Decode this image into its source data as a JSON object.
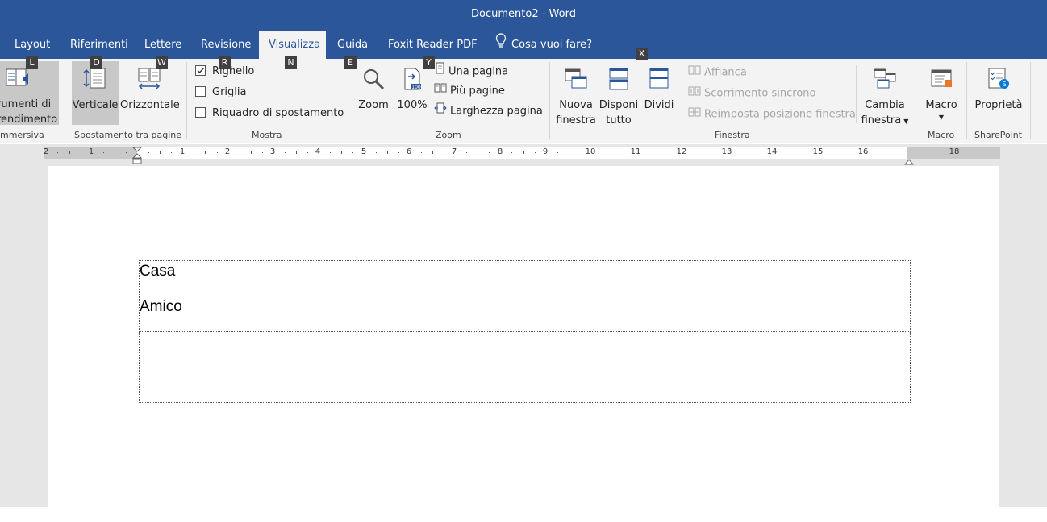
{
  "window": {
    "title": "Documento2  -  Word"
  },
  "tabs": [
    {
      "label": "Layout"
    },
    {
      "label": "Riferimenti"
    },
    {
      "label": "Lettere"
    },
    {
      "label": "Revisione"
    },
    {
      "label": "Visualizza"
    },
    {
      "label": "Guida"
    },
    {
      "label": "Foxit Reader PDF"
    },
    {
      "label": "Cosa vuoi fare?"
    }
  ],
  "active_tab": "Visualizza",
  "keytips": [
    "L",
    "D",
    "W",
    "R",
    "N",
    "E",
    "Y",
    "X"
  ],
  "ribbon": {
    "immersiva": {
      "button_line1": "rumenti di",
      "button_line2": "rendimento",
      "group_label": "mmersiva"
    },
    "spostamento": {
      "verticale": "Verticale",
      "orizzontale": "Orizzontale",
      "group_label": "Spostamento tra pagine"
    },
    "mostra": {
      "righello": "Righello",
      "griglia": "Griglia",
      "riquadro": "Riquadro di spostamento",
      "righello_checked": true,
      "griglia_checked": false,
      "riquadro_checked": false,
      "group_label": "Mostra"
    },
    "zoom": {
      "zoom": "Zoom",
      "cento": "100%",
      "una_pagina": "Una pagina",
      "piu_pagine": "Più pagine",
      "larghezza": "Larghezza pagina",
      "group_label": "Zoom"
    },
    "finestra": {
      "nuova_line1": "Nuova",
      "nuova_line2": "finestra",
      "disponi_line1": "Disponi",
      "disponi_line2": "tutto",
      "dividi": "Dividi",
      "affianca": "Affianca",
      "scorrimento": "Scorrimento sincrono",
      "reimposta": "Reimposta posizione finestra",
      "cambia_line1": "Cambia",
      "cambia_line2": "finestra",
      "group_label": "Finestra"
    },
    "macro": {
      "macro": "Macro",
      "group_label": "Macro"
    },
    "sharepoint": {
      "proprieta": "Proprietà",
      "group_label": "SharePoint"
    }
  },
  "ruler": {
    "labels": [
      "2",
      "1",
      "1",
      "2",
      "3",
      "4",
      "5",
      "6",
      "7",
      "8",
      "9",
      "10",
      "11",
      "12",
      "13",
      "14",
      "15",
      "16",
      "18"
    ]
  },
  "document": {
    "rows": [
      "Casa",
      "Amico",
      "",
      ""
    ]
  },
  "colors": {
    "titlebar": "#2b579a",
    "ribbon": "#f3f3f3",
    "workspace": "#e6e6e6",
    "accent_icon": "#2b579a"
  }
}
